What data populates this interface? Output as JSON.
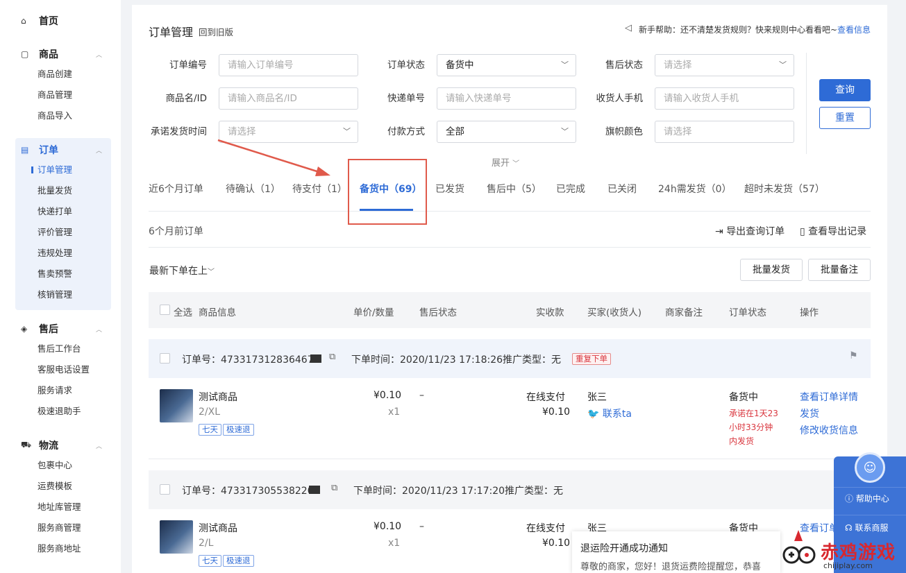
{
  "sidebar": {
    "home": "首页",
    "groups": [
      {
        "title": "商品",
        "items": [
          "商品创建",
          "商品管理",
          "商品导入"
        ]
      },
      {
        "title": "订单",
        "items": [
          "订单管理",
          "批量发货",
          "快递打单",
          "评价管理",
          "违规处理",
          "售卖预警",
          "核销管理"
        ]
      },
      {
        "title": "售后",
        "items": [
          "售后工作台",
          "客服电话设置",
          "服务请求",
          "极速退助手"
        ]
      },
      {
        "title": "物流",
        "items": [
          "包裹中心",
          "运费模板",
          "地址库管理",
          "服务商管理",
          "服务商地址"
        ]
      }
    ]
  },
  "header": {
    "title": "订单管理",
    "back_link": "回到旧版",
    "help_text": "新手帮助：还不清楚发货规则？快来规则中心看看吧~",
    "help_link": "查看信息"
  },
  "filters": {
    "order_no": {
      "label": "订单编号",
      "placeholder": "请输入订单编号"
    },
    "order_status": {
      "label": "订单状态",
      "value": "备货中"
    },
    "aftersale_status": {
      "label": "售后状态",
      "placeholder": "请选择"
    },
    "product": {
      "label": "商品名/ID",
      "placeholder": "请输入商品名/ID"
    },
    "express_no": {
      "label": "快递单号",
      "placeholder": "请输入快递单号"
    },
    "receiver_phone": {
      "label": "收货人手机",
      "placeholder": "请输入收货人手机"
    },
    "promise_time": {
      "label": "承诺发货时间",
      "placeholder": "请选择"
    },
    "payment": {
      "label": "付款方式",
      "value": "全部"
    },
    "flag_color": {
      "label": "旗帜颜色",
      "placeholder": "请选择"
    },
    "search_btn": "查询",
    "reset_btn": "重置",
    "expand": "展开"
  },
  "tabs": [
    "近6个月订单",
    "待确认（1）",
    "待支付（1）",
    "备货中（69）",
    "已发货",
    "售后中（5）",
    "已完成",
    "已关闭",
    "24h需发货（0）",
    "超时未发货（57）"
  ],
  "toolbar": {
    "old_orders": "6个月前订单",
    "export": "导出查询订单",
    "export_record": "查看导出记录",
    "sort": "最新下单在上",
    "batch_ship": "批量发货",
    "batch_note": "批量备注"
  },
  "table": {
    "select_all": "全选",
    "columns": [
      "商品信息",
      "单价/数量",
      "售后状态",
      "实收款",
      "买家(收货人)",
      "商家备注",
      "订单状态",
      "操作"
    ],
    "orders": [
      {
        "order_no_label": "订单号：",
        "order_no": "4733173128364676",
        "time_label": "下单时间：",
        "time": "2020/11/23 17:18:26",
        "promo_label": "推广类型：",
        "promo": "无",
        "repeat_tag": "重复下单",
        "product": "测试商品",
        "spec": "2/XL",
        "tags": [
          "七天",
          "极速退"
        ],
        "price": "¥0.10",
        "qty": "x1",
        "aftersale": "–",
        "pay_method": "在线支付",
        "paid": "¥0.10",
        "buyer": "张三",
        "contact": "联系ta",
        "status": "备货中",
        "promise": [
          "承诺在1天23",
          "小时33分钟",
          "内发货"
        ],
        "actions": [
          "查看订单详情",
          "发货",
          "修改收货信息"
        ]
      },
      {
        "order_no_label": "订单号：",
        "order_no": "4733173055382205",
        "time_label": "下单时间：",
        "time": "2020/11/23 17:17:20",
        "promo_label": "推广类型：",
        "promo": "无",
        "product": "测试商品",
        "spec": "2/L",
        "tags": [
          "七天",
          "极速退"
        ],
        "price": "¥0.10",
        "qty": "x1",
        "aftersale": "–",
        "pay_method": "在线支付",
        "paid": "¥0.10",
        "buyer": "张三",
        "status": "备货中",
        "action": "查看订单"
      }
    ]
  },
  "side_help": {
    "help_center": "帮助中心",
    "contact": "联系商服"
  },
  "notification": {
    "title": "退运险开通成功通知",
    "body": "尊敬的商家，您好！退货运费险提醒您，恭喜"
  },
  "watermark": {
    "name": "赤鸡游戏",
    "url": "chijiplay.com"
  },
  "colors": {
    "accent": "#2e6bd6",
    "annotation": "#e05a4b"
  }
}
